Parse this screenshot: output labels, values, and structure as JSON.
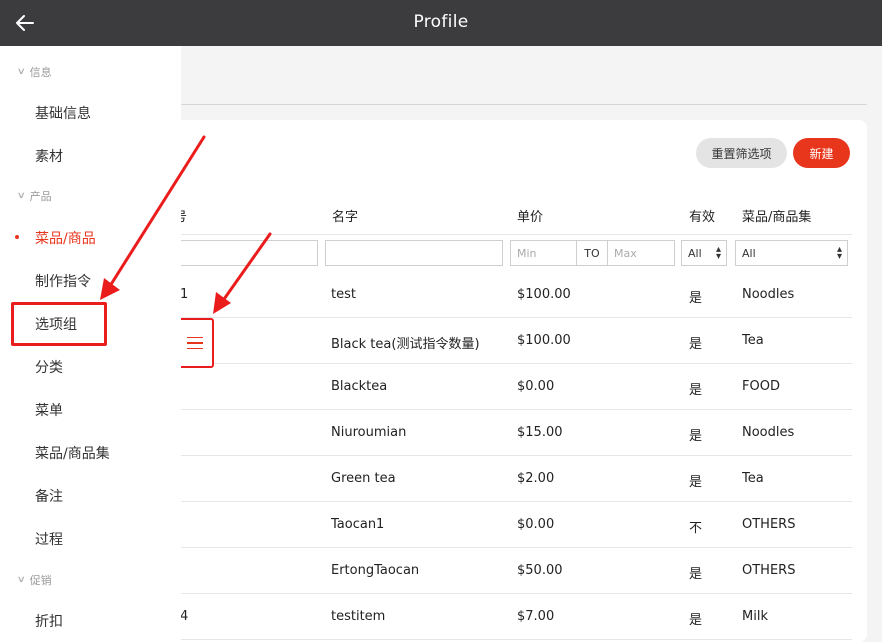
{
  "header": {
    "title": "Profile",
    "back_icon": "arrow-left-icon"
  },
  "sidebar": {
    "sections": [
      {
        "label": "信息",
        "items": [
          "基础信息",
          "素材"
        ]
      },
      {
        "label": "产品",
        "items": [
          "菜品/商品",
          "制作指令",
          "选项组",
          "分类",
          "菜单",
          "菜品/商品集",
          "备注",
          "过程"
        ]
      },
      {
        "label": "促销",
        "items": [
          "折扣"
        ]
      }
    ],
    "active_item": "菜品/商品",
    "highlighted_item": "选项组"
  },
  "toolbar": {
    "reset_label": "重置筛选项",
    "new_label": "新建"
  },
  "table": {
    "columns": [
      "号",
      "名字",
      "单价",
      "有效",
      "菜品/商品集"
    ],
    "filters": {
      "price_min_placeholder": "Min",
      "price_to": "TO",
      "price_max_placeholder": "Max",
      "valid_value": "All",
      "collection_value": "All"
    },
    "rows": [
      {
        "id": "1",
        "name": "test",
        "price": "$100.00",
        "valid": "是",
        "collection": "Noodles"
      },
      {
        "id": "",
        "name": "Black tea(测试指令数量)",
        "price": "$100.00",
        "valid": "是",
        "collection": "Tea"
      },
      {
        "id": "",
        "name": "Blacktea",
        "price": "$0.00",
        "valid": "是",
        "collection": "FOOD"
      },
      {
        "id": "",
        "name": "Niuroumian",
        "price": "$15.00",
        "valid": "是",
        "collection": "Noodles"
      },
      {
        "id": "",
        "name": "Green tea",
        "price": "$2.00",
        "valid": "是",
        "collection": "Tea"
      },
      {
        "id": "",
        "name": "Taocan1",
        "price": "$0.00",
        "valid": "不",
        "collection": "OTHERS"
      },
      {
        "id": "",
        "name": "ErtongTaocan",
        "price": "$50.00",
        "valid": "是",
        "collection": "OTHERS"
      },
      {
        "id": "4",
        "name": "testitem",
        "price": "$7.00",
        "valid": "是",
        "collection": "Milk"
      }
    ]
  },
  "colors": {
    "accent": "#e8361d",
    "annotation": "#ea1c1c",
    "topbar": "#3c3c3f"
  },
  "icons": {
    "drag_handle": "hamburger-menu-icon",
    "sort": "sort-chevrons-icon",
    "section": "chevron-down-icon"
  }
}
